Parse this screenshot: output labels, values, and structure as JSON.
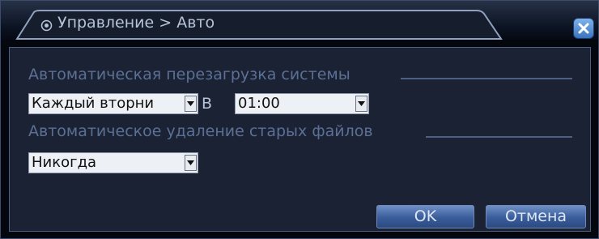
{
  "window": {
    "title": "Управление > Авто",
    "close_icon": "close-icon"
  },
  "reboot": {
    "section_label": "Автоматическая перезагрузка системы",
    "schedule_value": "Каждый вторни",
    "at_label": "В",
    "time_value": "01:00"
  },
  "cleanup": {
    "section_label": "Автоматическое удаление старых файлов",
    "value": "Никогда"
  },
  "buttons": {
    "ok_label": "OK",
    "cancel_label": "Отмена"
  }
}
